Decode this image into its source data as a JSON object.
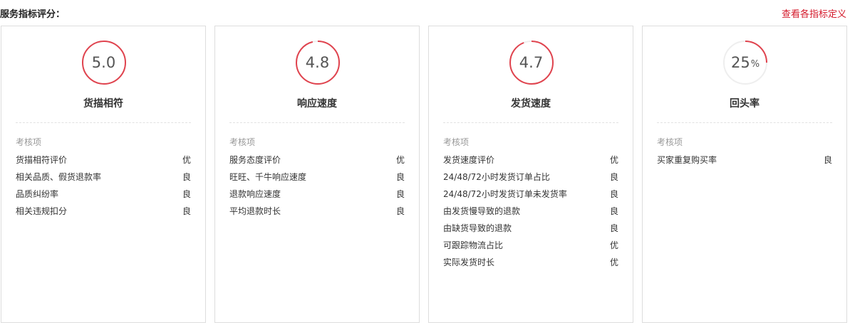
{
  "header": {
    "title": "服务指标评分：",
    "definitions_link": "查看各指标定义"
  },
  "colors": {
    "accent": "#e0434e",
    "track": "#eeeeee",
    "link": "#d4192a"
  },
  "cards": [
    {
      "score": "5.0",
      "unit": "",
      "ring_fill": 1.0,
      "title": "货描相符",
      "items_header": "考核项",
      "items": [
        {
          "label": "货描相符评价",
          "grade": "优"
        },
        {
          "label": "相关品质、假货退款率",
          "grade": "良"
        },
        {
          "label": "品质纠纷率",
          "grade": "良"
        },
        {
          "label": "相关违规扣分",
          "grade": "良"
        }
      ]
    },
    {
      "score": "4.8",
      "unit": "",
      "ring_fill": 0.96,
      "title": "响应速度",
      "items_header": "考核项",
      "items": [
        {
          "label": "服务态度评价",
          "grade": "优"
        },
        {
          "label": "旺旺、千牛响应速度",
          "grade": "良"
        },
        {
          "label": "退款响应速度",
          "grade": "良"
        },
        {
          "label": "平均退款时长",
          "grade": "良"
        }
      ]
    },
    {
      "score": "4.7",
      "unit": "",
      "ring_fill": 0.94,
      "title": "发货速度",
      "items_header": "考核项",
      "items": [
        {
          "label": "发货速度评价",
          "grade": "优"
        },
        {
          "label": "24/48/72小时发货订单占比",
          "grade": "良"
        },
        {
          "label": "24/48/72小时发货订单未发货率",
          "grade": "良"
        },
        {
          "label": "由发货慢导致的退款",
          "grade": "良"
        },
        {
          "label": "由缺货导致的退款",
          "grade": "良"
        },
        {
          "label": "可跟踪物流占比",
          "grade": "优"
        },
        {
          "label": "实际发货时长",
          "grade": "优"
        }
      ]
    },
    {
      "score": "25",
      "unit": "%",
      "ring_fill": 0.25,
      "title": "回头率",
      "items_header": "考核项",
      "items": [
        {
          "label": "买家重复购买率",
          "grade": "良"
        }
      ]
    }
  ]
}
